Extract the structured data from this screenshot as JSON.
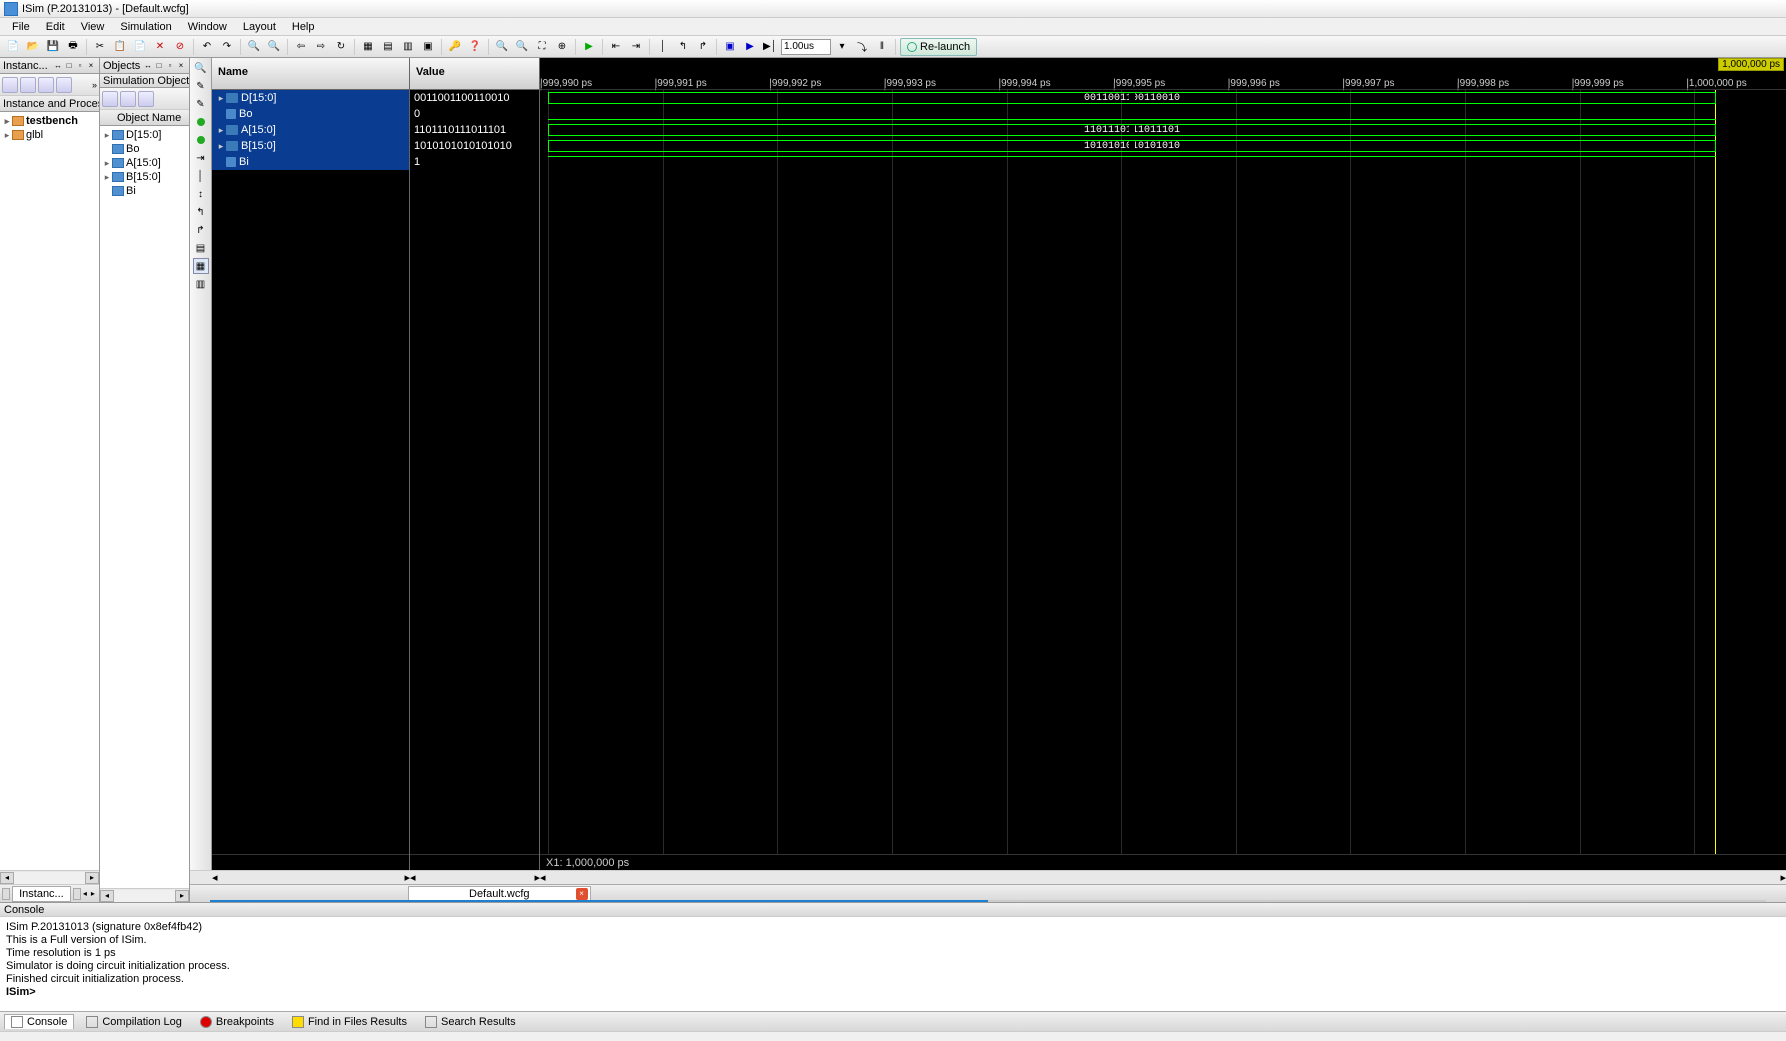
{
  "title": "ISim (P.20131013) - [Default.wcfg]",
  "menus": [
    "File",
    "Edit",
    "View",
    "Simulation",
    "Window",
    "Layout",
    "Help"
  ],
  "relaunch": "Re-launch",
  "timeval": "1.00us",
  "instances_panel": {
    "title": "Instanc...",
    "header": "Instance and Proces"
  },
  "instances": [
    {
      "name": "testbench",
      "bold": true
    },
    {
      "name": "glbl",
      "bold": false
    }
  ],
  "objects_panel": {
    "title": "Objects",
    "sub": "Simulation Objects ...",
    "colhdr": "Object Name"
  },
  "objects": [
    "D[15:0]",
    "Bo",
    "A[15:0]",
    "B[15:0]",
    "Bi"
  ],
  "name_hdr": "Name",
  "value_hdr": "Value",
  "signals": [
    {
      "name": "D[15:0]",
      "value": "0011001100110010",
      "bus": true,
      "exp": true
    },
    {
      "name": "Bo",
      "value": "0",
      "bus": false,
      "high": false
    },
    {
      "name": "A[15:0]",
      "value": "1101110111011101",
      "bus": true,
      "exp": true
    },
    {
      "name": "B[15:0]",
      "value": "1010101010101010",
      "bus": true,
      "exp": true
    },
    {
      "name": "Bi",
      "value": "1",
      "bus": false,
      "high": true
    }
  ],
  "ruler_end": "1,000,000 ps",
  "ruler_ticks": [
    "999,990 ps",
    "999,991 ps",
    "999,992 ps",
    "999,993 ps",
    "999,994 ps",
    "999,995 ps",
    "999,996 ps",
    "999,997 ps",
    "999,998 ps",
    "999,999 ps",
    "1,000,000 ps"
  ],
  "cursor_label": "X1: 1,000,000 ps",
  "wave_tab": "Default.wcfg",
  "instance_tab": "Instanc...",
  "console_title": "Console",
  "console_lines": [
    "ISim P.20131013 (signature 0x8ef4fb42)",
    "This is a Full version of ISim.",
    "Time resolution is 1 ps",
    "Simulator is doing circuit initialization process.",
    "Finished circuit initialization process."
  ],
  "console_prompt": "ISim>",
  "console_tabs": [
    "Console",
    "Compilation Log",
    "Breakpoints",
    "Find in Files Results",
    "Search Results"
  ]
}
